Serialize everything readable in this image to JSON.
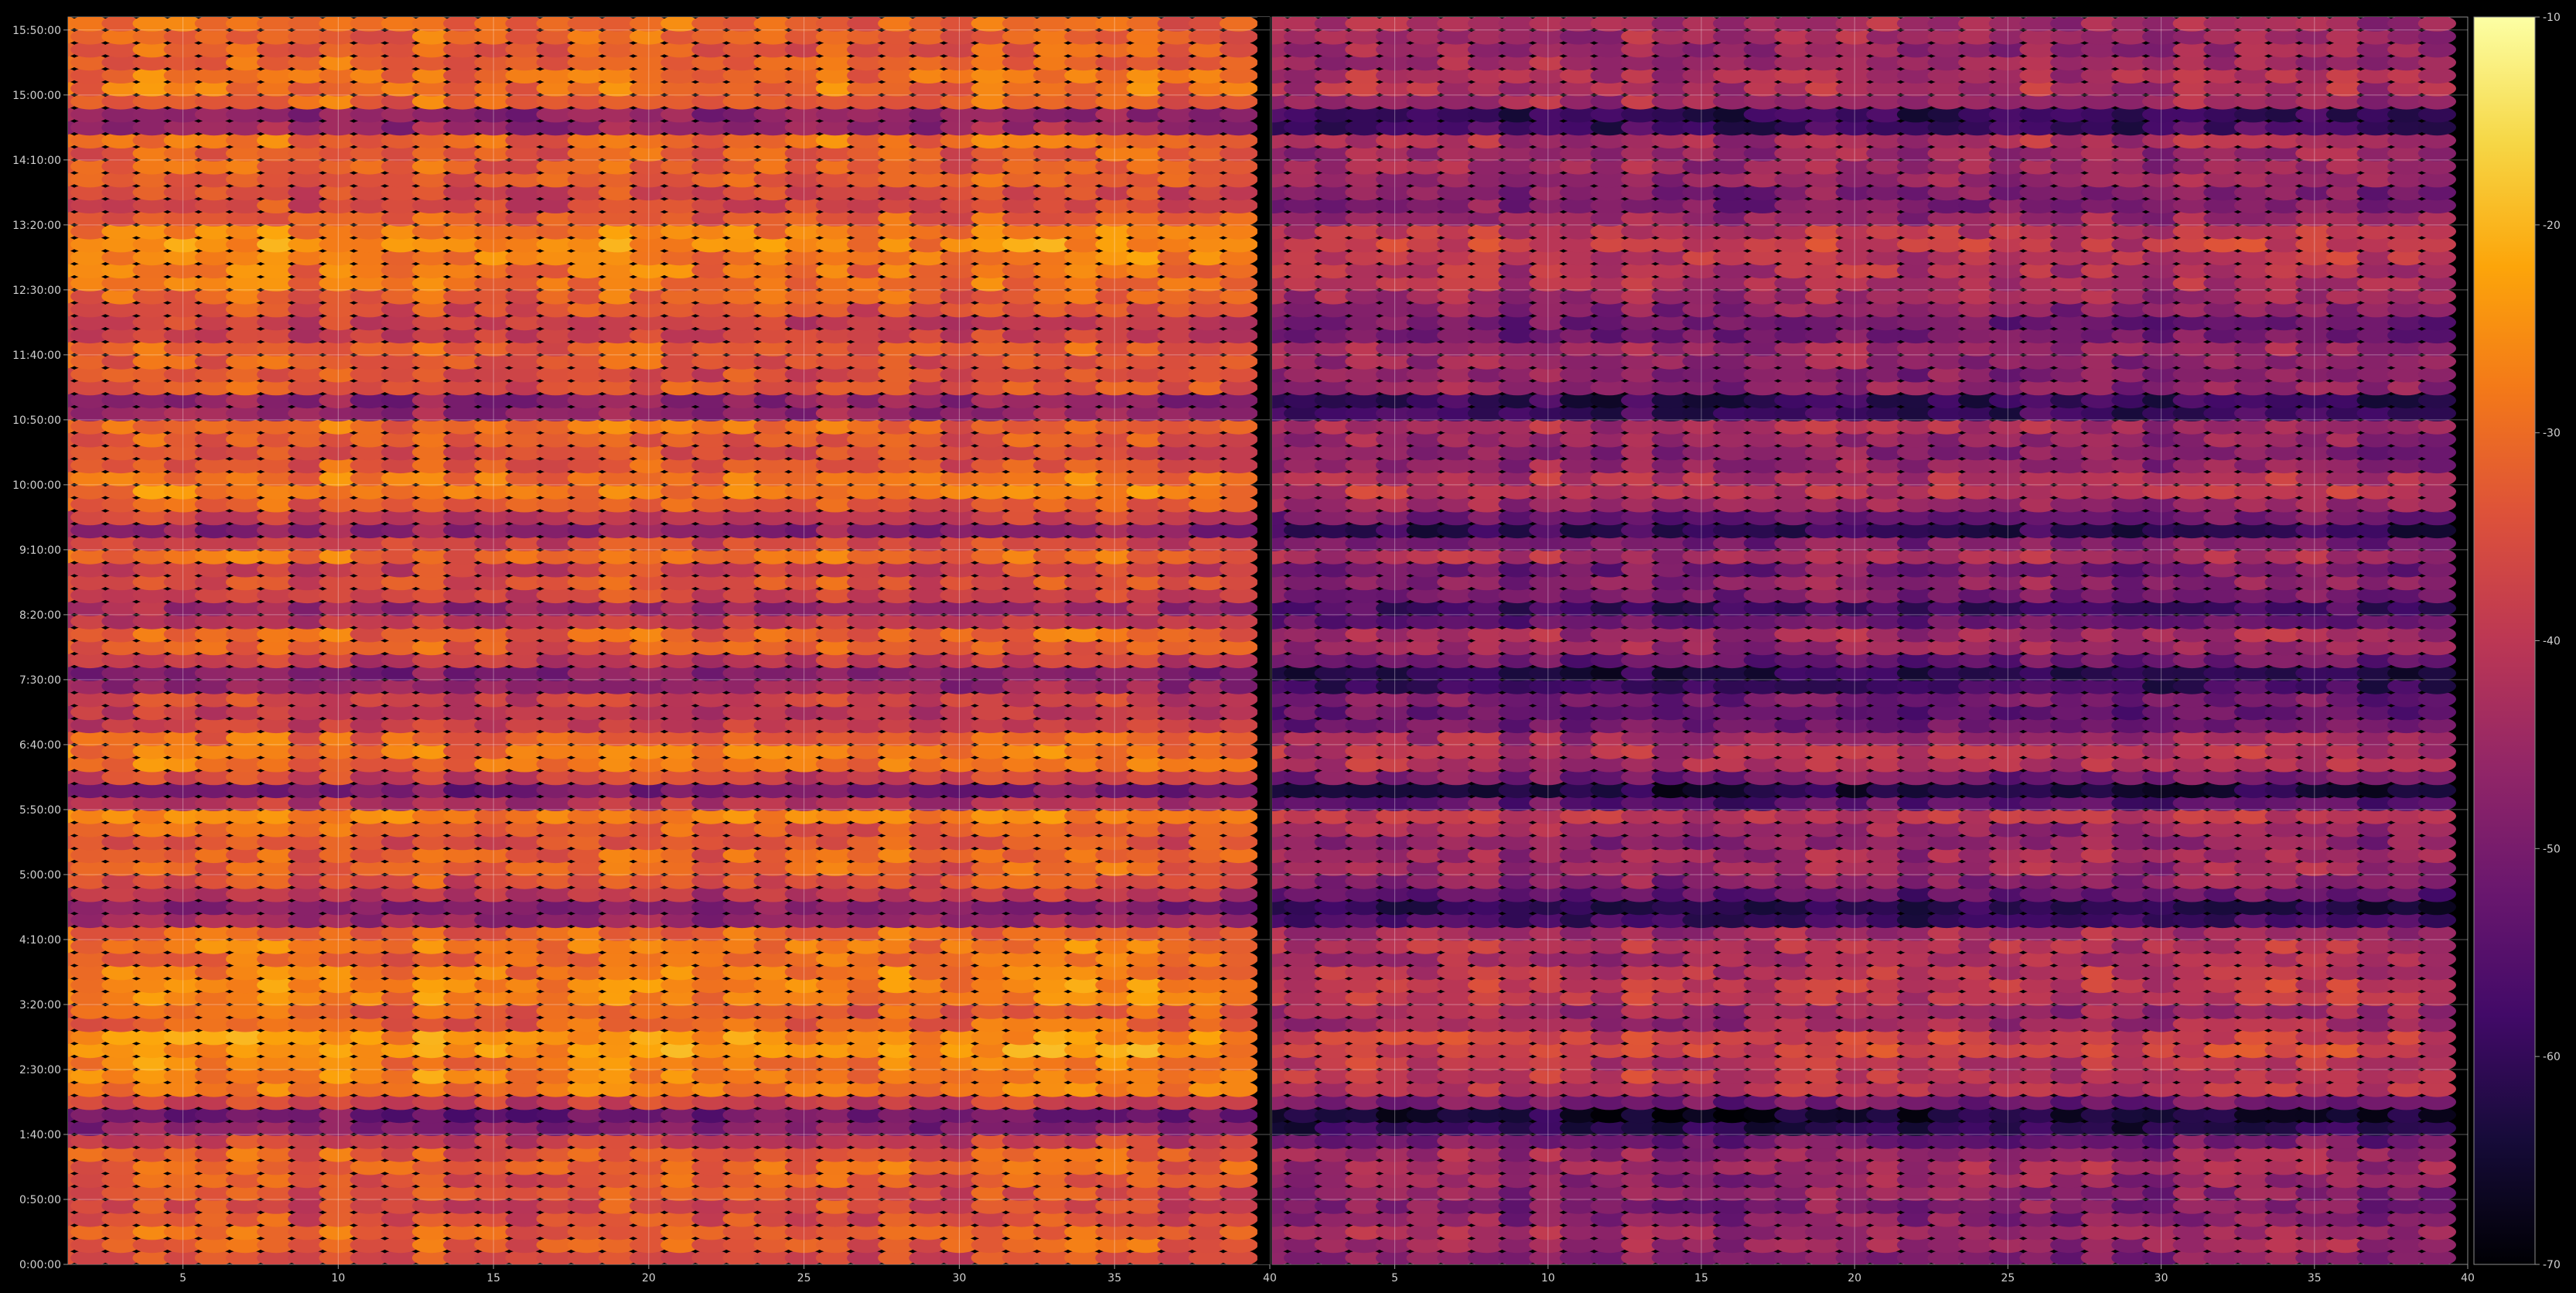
{
  "chart_data": {
    "type": "heatmap",
    "title": "",
    "colormap": "inferno",
    "background": "#000000",
    "grid": true,
    "panels": [
      {
        "name": "",
        "xlim": [
          1.3,
          40
        ],
        "x_ticks": [
          5,
          10,
          15,
          20,
          25,
          30,
          35,
          40
        ],
        "blank_column_x": [
          39.6,
          40
        ]
      },
      {
        "name": "",
        "xlim": [
          1,
          40
        ],
        "x_ticks": [
          5,
          10,
          15,
          20,
          25,
          30,
          35,
          40
        ]
      }
    ],
    "y_ticks": [
      "0:00:00",
      "0:50:00",
      "1:40:00",
      "2:30:00",
      "3:20:00",
      "4:10:00",
      "5:00:00",
      "5:50:00",
      "6:40:00",
      "7:30:00",
      "8:20:00",
      "9:10:00",
      "10:00:00",
      "10:50:00",
      "11:40:00",
      "12:30:00",
      "13:20:00",
      "14:10:00",
      "15:00:00",
      "15:50:00"
    ],
    "ylim_minutes": [
      0,
      960
    ],
    "x_columns": 39,
    "time_rows": 96,
    "row_step_minutes": 10,
    "panel2_offset_db": -13,
    "colorbar": {
      "min": -70,
      "max": -10,
      "ticks": [
        "-10",
        "-20",
        "-30",
        "-40",
        "-50",
        "-60",
        "-70"
      ]
    },
    "row_profile_db": [
      {
        "time": "0:00:00",
        "db": -37
      },
      {
        "time": "0:20:00",
        "db": -30
      },
      {
        "time": "0:40:00",
        "db": -36
      },
      {
        "time": "1:00:00",
        "db": -34
      },
      {
        "time": "1:20:00",
        "db": -30
      },
      {
        "time": "1:40:00",
        "db": -40
      },
      {
        "time": "1:50:00",
        "db": -58
      },
      {
        "time": "2:10:00",
        "db": -31
      },
      {
        "time": "2:20:00",
        "db": -24
      },
      {
        "time": "2:30:00",
        "db": -29
      },
      {
        "time": "2:50:00",
        "db": -22
      },
      {
        "time": "3:10:00",
        "db": -34
      },
      {
        "time": "3:20:00",
        "db": -28
      },
      {
        "time": "3:40:00",
        "db": -26
      },
      {
        "time": "4:00:00",
        "db": -32
      },
      {
        "time": "4:10:00",
        "db": -24
      },
      {
        "time": "4:30:00",
        "db": -52
      },
      {
        "time": "4:50:00",
        "db": -36
      },
      {
        "time": "5:10:00",
        "db": -30
      },
      {
        "time": "5:30:00",
        "db": -35
      },
      {
        "time": "5:50:00",
        "db": -24
      },
      {
        "time": "6:00:00",
        "db": -58
      },
      {
        "time": "6:20:00",
        "db": -30
      },
      {
        "time": "6:40:00",
        "db": -27
      },
      {
        "time": "7:00:00",
        "db": -42
      },
      {
        "time": "7:20:00",
        "db": -36
      },
      {
        "time": "7:30:00",
        "db": -55
      },
      {
        "time": "7:50:00",
        "db": -33
      },
      {
        "time": "8:10:00",
        "db": -30
      },
      {
        "time": "8:20:00",
        "db": -49
      },
      {
        "time": "8:40:00",
        "db": -33
      },
      {
        "time": "9:00:00",
        "db": -39
      },
      {
        "time": "9:10:00",
        "db": -22
      },
      {
        "time": "9:20:00",
        "db": -52
      },
      {
        "time": "9:40:00",
        "db": -34
      },
      {
        "time": "10:00:00",
        "db": -26
      },
      {
        "time": "10:20:00",
        "db": -36
      },
      {
        "time": "10:40:00",
        "db": -32
      },
      {
        "time": "10:50:00",
        "db": -29
      },
      {
        "time": "11:00:00",
        "db": -62
      },
      {
        "time": "11:10:00",
        "db": -33
      },
      {
        "time": "11:30:00",
        "db": -36
      },
      {
        "time": "11:40:00",
        "db": -30
      },
      {
        "time": "12:00:00",
        "db": -40
      },
      {
        "time": "12:20:00",
        "db": -32
      },
      {
        "time": "12:30:00",
        "db": -30
      },
      {
        "time": "12:50:00",
        "db": -28
      },
      {
        "time": "13:10:00",
        "db": -25
      },
      {
        "time": "13:20:00",
        "db": -30
      },
      {
        "time": "13:40:00",
        "db": -38
      },
      {
        "time": "14:00:00",
        "db": -30
      },
      {
        "time": "14:10:00",
        "db": -34
      },
      {
        "time": "14:30:00",
        "db": -28
      },
      {
        "time": "14:40:00",
        "db": -62
      },
      {
        "time": "14:50:00",
        "db": -32
      },
      {
        "time": "15:10:00",
        "db": -28
      },
      {
        "time": "15:30:00",
        "db": -33
      },
      {
        "time": "15:50:00",
        "db": -30
      },
      {
        "time": "16:00:00",
        "db": -31
      }
    ]
  }
}
